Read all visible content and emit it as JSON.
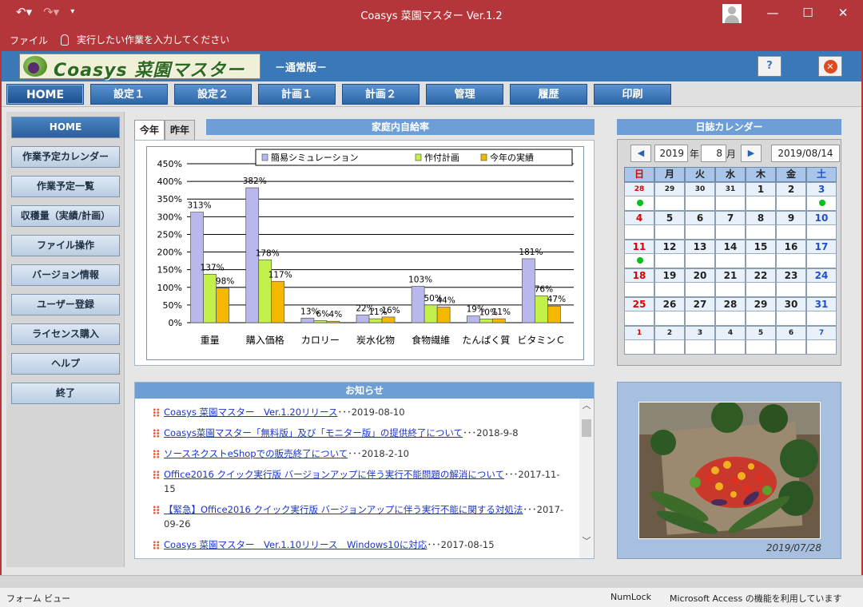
{
  "window": {
    "title": "Coasys 菜園マスター Ver.1.2",
    "file_menu": "ファイル",
    "tell_me": "実行したい作業を入力してください"
  },
  "header": {
    "logo_text": "Coasys 菜園マスター",
    "edition": "－通常版－",
    "help_label": "?"
  },
  "tabs": [
    "HOME",
    "設定１",
    "設定２",
    "計画１",
    "計画２",
    "管理",
    "履歴",
    "印刷"
  ],
  "sidebar": {
    "items": [
      "HOME",
      "作業予定カレンダー",
      "作業予定一覧",
      "収穫量（実績/計画）",
      "ファイル操作",
      "バージョン情報",
      "ユーザー登録",
      "ライセンス購入",
      "ヘルプ",
      "終了"
    ]
  },
  "selfsuff": {
    "tab_this_year": "今年",
    "tab_last_year": "昨年",
    "heading": "家庭内自給率"
  },
  "chart_data": {
    "type": "bar",
    "title": "",
    "categories": [
      "重量",
      "購入価格",
      "カロリー",
      "炭水化物",
      "食物繊維",
      "たんぱく質",
      "ビタミンＣ"
    ],
    "series": [
      {
        "name": "簡易シミュレーション",
        "values": [
          313,
          382,
          13,
          22,
          103,
          19,
          181
        ],
        "labels": [
          "313%",
          "382%",
          "13%",
          "22%",
          "103%",
          "19%",
          "181%"
        ],
        "color": "#b8b8ec"
      },
      {
        "name": "作付計画",
        "values": [
          137,
          178,
          6,
          11,
          50,
          10,
          76
        ],
        "labels": [
          "137%",
          "178%",
          "6%",
          "11%",
          "50%",
          "10%",
          "76%"
        ],
        "color": "#c4f04a"
      },
      {
        "name": "今年の実績",
        "values": [
          98,
          117,
          4,
          16,
          44,
          11,
          47
        ],
        "labels": [
          "98%",
          "117%",
          "4%",
          "16%",
          "44%",
          "11%",
          "47%"
        ],
        "color": "#f5b800"
      }
    ],
    "yticks": [
      "0%",
      "50%",
      "100%",
      "150%",
      "200%",
      "250%",
      "300%",
      "350%",
      "400%",
      "450%"
    ],
    "ylim": [
      0,
      450
    ],
    "legend": "top"
  },
  "news": {
    "heading": "お知らせ",
    "items": [
      {
        "text": "Coasys 菜園マスター　Ver.1.20リリース",
        "date": "･･･2019-08-10"
      },
      {
        "text": "Coasys菜園マスター「無料版」及び「モニター版」の提供終了について",
        "date": "･･･2018-9-8"
      },
      {
        "text": "ソースネクストeShopでの販売終了について",
        "date": "･･･2018-2-10"
      },
      {
        "text": "Office2016 クイック実行版 バージョンアップに伴う実行不能問題の解消について",
        "date": "･･･2017-11-15"
      },
      {
        "text": "【緊急】Office2016 クイック実行版 バージョンアップに伴う実行不能に関する対処法",
        "date": "･･･2017-09-26"
      },
      {
        "text": "Coasys 菜園マスター　Ver.1.10リリース　Windows10に対応",
        "date": "･･･2017-08-15"
      }
    ]
  },
  "calendar": {
    "heading": "日誌カレンダー",
    "year": "2019",
    "year_suffix": "年",
    "month": "8",
    "month_suffix": "月",
    "date": "2019/08/14",
    "weekdays": [
      "日",
      "月",
      "火",
      "水",
      "木",
      "金",
      "土"
    ],
    "weeks": [
      [
        {
          "d": "28",
          "small": true,
          "dot": true
        },
        {
          "d": "29",
          "small": true
        },
        {
          "d": "30",
          "small": true
        },
        {
          "d": "31",
          "small": true
        },
        {
          "d": "1"
        },
        {
          "d": "2"
        },
        {
          "d": "3",
          "dot": true
        }
      ],
      [
        {
          "d": "4"
        },
        {
          "d": "5"
        },
        {
          "d": "6"
        },
        {
          "d": "7"
        },
        {
          "d": "8"
        },
        {
          "d": "9"
        },
        {
          "d": "10"
        }
      ],
      [
        {
          "d": "11",
          "dot": true
        },
        {
          "d": "12"
        },
        {
          "d": "13"
        },
        {
          "d": "14"
        },
        {
          "d": "15"
        },
        {
          "d": "16"
        },
        {
          "d": "17"
        }
      ],
      [
        {
          "d": "18"
        },
        {
          "d": "19"
        },
        {
          "d": "20"
        },
        {
          "d": "21"
        },
        {
          "d": "22"
        },
        {
          "d": "23"
        },
        {
          "d": "24"
        }
      ],
      [
        {
          "d": "25"
        },
        {
          "d": "26"
        },
        {
          "d": "27"
        },
        {
          "d": "28"
        },
        {
          "d": "29"
        },
        {
          "d": "30"
        },
        {
          "d": "31"
        }
      ],
      [
        {
          "d": "1",
          "small": true
        },
        {
          "d": "2",
          "small": true
        },
        {
          "d": "3",
          "small": true
        },
        {
          "d": "4",
          "small": true
        },
        {
          "d": "5",
          "small": true
        },
        {
          "d": "6",
          "small": true
        },
        {
          "d": "7",
          "small": true
        }
      ]
    ]
  },
  "photo": {
    "caption": "2019/07/28"
  },
  "statusbar": {
    "left": "フォーム ビュー",
    "numlock": "NumLock",
    "right": "Microsoft Access の機能を利用しています"
  }
}
